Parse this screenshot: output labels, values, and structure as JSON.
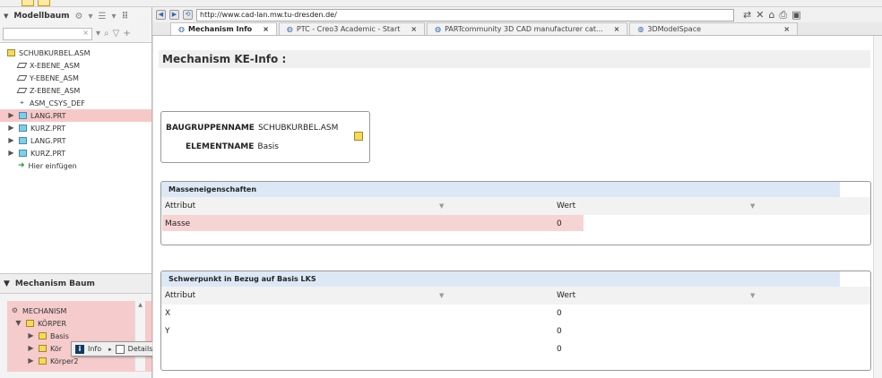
{
  "left_panel": {
    "header": "Modellbaum",
    "search_value": "×",
    "tree": [
      {
        "label": "SCHUBKURBEL.ASM",
        "icon": "assembly-icon",
        "indent": 0,
        "expand": "",
        "selected": false
      },
      {
        "label": "X-EBENE_ASM",
        "icon": "plane-icon",
        "indent": 1,
        "expand": "",
        "selected": false
      },
      {
        "label": "Y-EBENE_ASM",
        "icon": "plane-icon",
        "indent": 1,
        "expand": "",
        "selected": false
      },
      {
        "label": "Z-EBENE_ASM",
        "icon": "plane-icon",
        "indent": 1,
        "expand": "",
        "selected": false
      },
      {
        "label": "ASM_CSYS_DEF",
        "icon": "csys-icon",
        "indent": 1,
        "expand": "",
        "selected": false
      },
      {
        "label": "LANG.PRT",
        "icon": "part-icon",
        "indent": 0,
        "expand": "▶",
        "selected": true
      },
      {
        "label": "KURZ.PRT",
        "icon": "part-icon",
        "indent": 0,
        "expand": "▶",
        "selected": false
      },
      {
        "label": "LANG.PRT",
        "icon": "part-icon",
        "indent": 0,
        "expand": "▶",
        "selected": false
      },
      {
        "label": "KURZ.PRT",
        "icon": "part-icon",
        "indent": 0,
        "expand": "▶",
        "selected": false
      },
      {
        "label": "Hier einfügen",
        "icon": "insert-arrow-icon",
        "indent": 1,
        "expand": "",
        "selected": false
      }
    ],
    "mechanism_header": "Mechanism Baum",
    "mech_tree": [
      {
        "label": "MECHANISM",
        "expand": ""
      },
      {
        "label": "KÖRPER",
        "expand": "▼"
      },
      {
        "label": "Basis",
        "expand": "▶"
      },
      {
        "label": "Kör",
        "expand": "▶"
      },
      {
        "label": "Körper2",
        "expand": "▶"
      }
    ]
  },
  "context_menu": {
    "info_label": "Info",
    "details_label": "Details"
  },
  "browser": {
    "url": "http://www.cad-lan.mw.tu-dresden.de/",
    "tabs": [
      {
        "label": "Mechanism Info",
        "active": true
      },
      {
        "label": "PTC - Creo3 Academic - Start",
        "active": false
      },
      {
        "label": "PARTcommunity 3D CAD manufacturer cat...",
        "active": false
      },
      {
        "label": "3DModelSpace",
        "active": false
      }
    ]
  },
  "page": {
    "title": "Mechanism KE-Info :",
    "info": {
      "baugruppe_label": "BAUGRUPPENNAME",
      "baugruppe_value": "SCHUBKURBEL.ASM",
      "element_label": "ELEMENTNAME",
      "element_value": "Basis"
    },
    "mass_section": {
      "title": "Masseneigenschaften",
      "col_attr": "Attribut",
      "col_value": "Wert",
      "rows": [
        {
          "attr": "Masse",
          "value": "0"
        }
      ]
    },
    "cog_section": {
      "title": "Schwerpunkt in Bezug auf Basis LKS",
      "col_attr": "Attribut",
      "col_value": "Wert",
      "rows": [
        {
          "attr": "X",
          "value": "0"
        },
        {
          "attr": "Y",
          "value": "0"
        },
        {
          "attr": "",
          "value": "0"
        }
      ]
    }
  }
}
